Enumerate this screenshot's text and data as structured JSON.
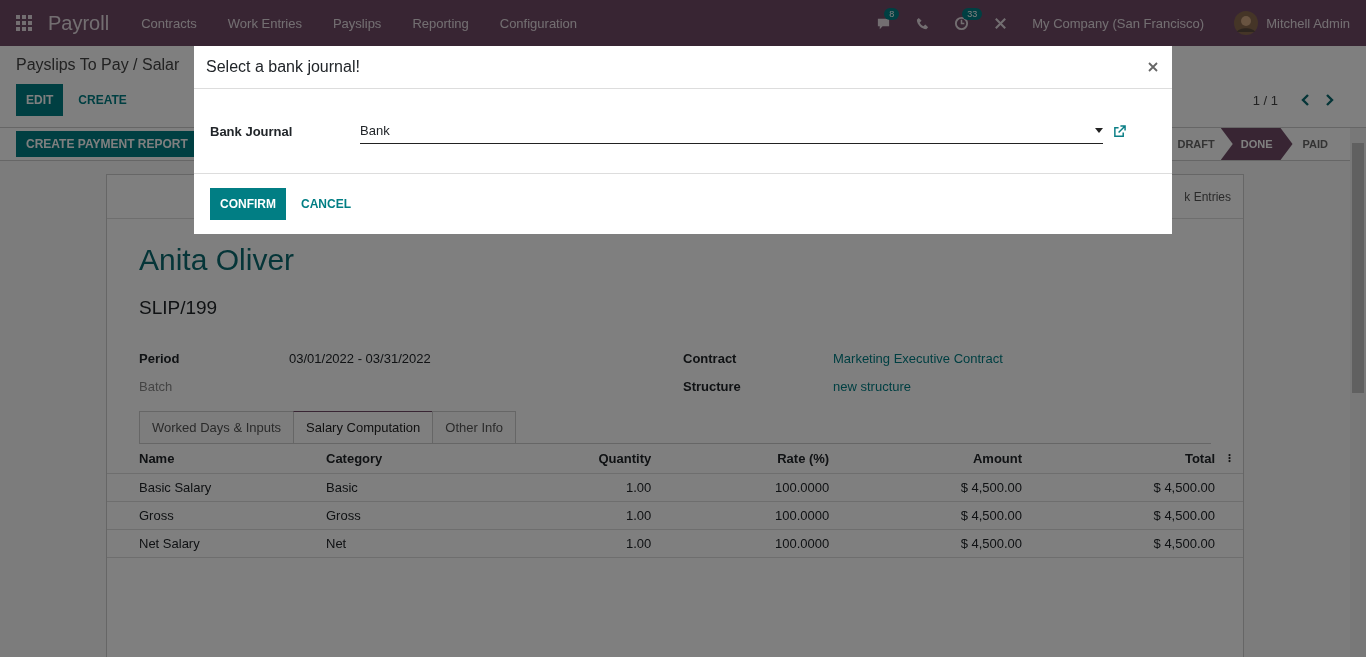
{
  "navbar": {
    "app_name": "Payroll",
    "menu": [
      "Contracts",
      "Work Entries",
      "Payslips",
      "Reporting",
      "Configuration"
    ],
    "messages_badge": "8",
    "activities_badge": "33",
    "company": "My Company (San Francisco)",
    "user": "Mitchell Admin"
  },
  "breadcrumb": "Payslips To Pay / Salar",
  "actions": [
    "EDIT",
    "CREATE"
  ],
  "pager": "1 / 1",
  "header_button": "CREATE PAYMENT REPORT",
  "statuses": [
    {
      "label": "DRAFT",
      "selected": false
    },
    {
      "label": "DONE",
      "selected": true
    },
    {
      "label": "PAID",
      "selected": false
    }
  ],
  "smart_button": "k Entries",
  "employee": "Anita Oliver",
  "reference": "SLIP/199",
  "fields_left": [
    {
      "label": "Period",
      "value": "03/01/2022 - 03/31/2022",
      "link": false,
      "muted": false
    },
    {
      "label": "Batch",
      "muted": true
    }
  ],
  "fields_right": [
    {
      "label": "Contract",
      "value": "Marketing Executive Contract",
      "link": true,
      "muted": false
    },
    {
      "label": "Structure",
      "value": "new structure",
      "link": true,
      "muted": false
    }
  ],
  "tabs": [
    {
      "label": "Worked Days & Inputs",
      "selected": false
    },
    {
      "label": "Salary Computation",
      "selected": true
    },
    {
      "label": "Other Info",
      "selected": false
    }
  ],
  "table": {
    "columns": [
      "Name",
      "Category",
      "Quantity",
      "Rate (%)",
      "Amount",
      "Total"
    ],
    "rows": [
      [
        "Basic Salary",
        "Basic",
        "1.00",
        "100.0000",
        "$ 4,500.00",
        "$ 4,500.00"
      ],
      [
        "Gross",
        "Gross",
        "1.00",
        "100.0000",
        "$ 4,500.00",
        "$ 4,500.00"
      ],
      [
        "Net Salary",
        "Net",
        "1.00",
        "100.0000",
        "$ 4,500.00",
        "$ 4,500.00"
      ]
    ]
  },
  "dialog": {
    "title": "Select a bank journal!",
    "field_label": "Bank Journal",
    "field_value": "Bank",
    "buttons": [
      {
        "label": "CONFIRM",
        "kind": "primary"
      },
      {
        "label": "CANCEL",
        "kind": "link"
      }
    ]
  }
}
